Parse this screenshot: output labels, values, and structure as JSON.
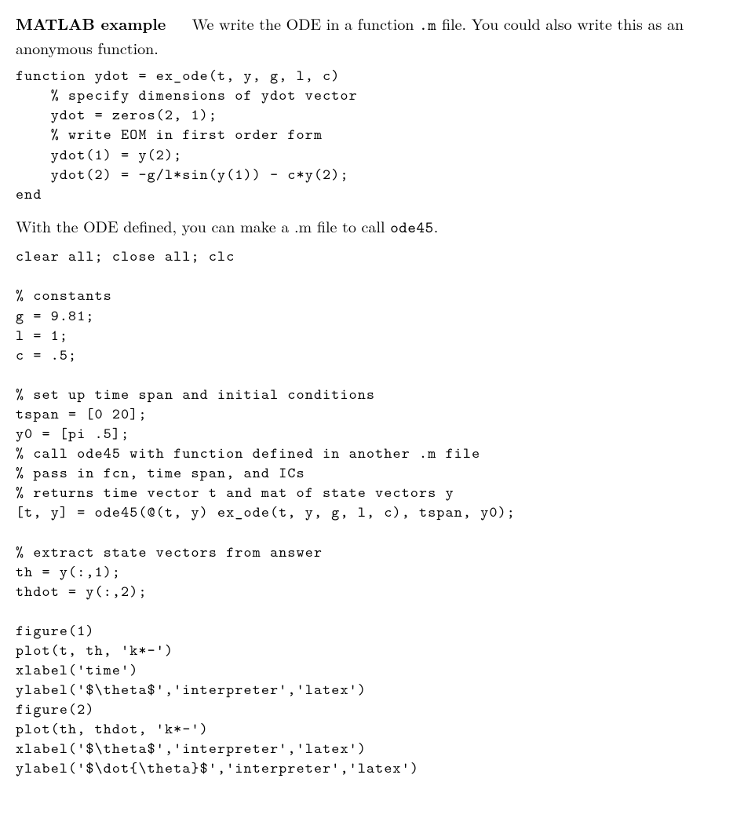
{
  "para1": {
    "heading": "MATLAB example",
    "body_before_code": "We write the ODE in a function ",
    "inline1": ".m",
    "body_after_code": " file. You could also write this as an anonymous function."
  },
  "code1": "function ydot = ex_ode(t, y, g, l, c)\n    % specify dimensions of ydot vector\n    ydot = zeros(2, 1);\n    % write EOM in first order form\n    ydot(1) = y(2);\n    ydot(2) = -g/l*sin(y(1)) - c*y(2);\nend",
  "para2": {
    "body_before": "With the ODE defined, you can make a .m file to call ",
    "inline": "ode45",
    "body_after": "."
  },
  "code2": "clear all; close all; clc\n\n% constants\ng = 9.81;\nl = 1;\nc = .5;\n\n% set up time span and initial conditions\ntspan = [0 20];\ny0 = [pi .5];\n% call ode45 with function defined in another .m file\n% pass in fcn, time span, and ICs\n% returns time vector t and mat of state vectors y\n[t, y] = ode45(@(t, y) ex_ode(t, y, g, l, c), tspan, y0);\n\n% extract state vectors from answer\nth = y(:,1);\nthdot = y(:,2);\n\nfigure(1)\nplot(t, th, 'k*-')\nxlabel('time')\nylabel('$\\theta$','interpreter','latex')\nfigure(2)\nplot(th, thdot, 'k*-')\nxlabel('$\\theta$','interpreter','latex')\nylabel('$\\dot{\\theta}$','interpreter','latex')"
}
